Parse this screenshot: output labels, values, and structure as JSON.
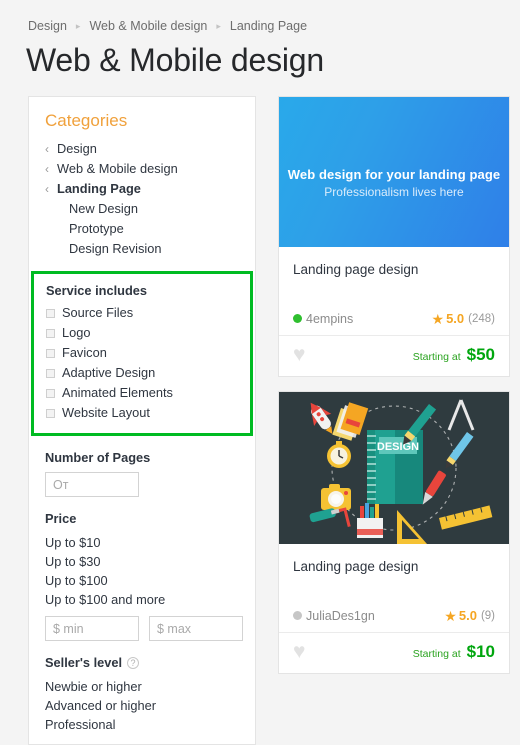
{
  "breadcrumb": {
    "separator": "▸",
    "items": [
      {
        "label": "Design"
      },
      {
        "label": "Web & Mobile design"
      },
      {
        "label": "Landing Page"
      }
    ]
  },
  "page_title": "Web & Mobile design",
  "sidebar": {
    "categories": {
      "title": "Categories",
      "chevron": "‹",
      "parents": [
        {
          "label": "Design",
          "current": false
        },
        {
          "label": "Web & Mobile design",
          "current": false
        },
        {
          "label": "Landing Page",
          "current": true
        }
      ],
      "children": [
        {
          "label": "New Design"
        },
        {
          "label": "Prototype"
        },
        {
          "label": "Design Revision"
        }
      ]
    },
    "service_includes": {
      "title": "Service includes",
      "highlight_color": "#00bb22",
      "options": [
        {
          "label": "Source Files",
          "checked": false
        },
        {
          "label": "Logo",
          "checked": false
        },
        {
          "label": "Favicon",
          "checked": false
        },
        {
          "label": "Adaptive Design",
          "checked": false
        },
        {
          "label": "Animated Elements",
          "checked": false
        },
        {
          "label": "Website Layout",
          "checked": false
        }
      ]
    },
    "number_of_pages": {
      "title": "Number of Pages",
      "input_placeholder": "От",
      "input_value": ""
    },
    "price": {
      "title": "Price",
      "options": [
        {
          "label": "Up to $10"
        },
        {
          "label": "Up to $30"
        },
        {
          "label": "Up to $100"
        },
        {
          "label": "Up to $100 and more"
        }
      ],
      "min_placeholder": "$ min",
      "max_placeholder": "$ max",
      "min_value": "",
      "max_value": ""
    },
    "sellers_level": {
      "title": "Seller's level",
      "help_glyph": "?",
      "options": [
        {
          "label": "Newbie or higher"
        },
        {
          "label": "Advanced or higher"
        },
        {
          "label": "Professional"
        }
      ]
    }
  },
  "cards": [
    {
      "banner": {
        "kind": "gradient-text",
        "headline": "Web design for your landing page",
        "subline": "Professionalism lives here"
      },
      "title": "Landing page design",
      "seller": "4empins",
      "seller_status_color": "#2fbf2f",
      "star_glyph": "★",
      "rating": "5.0",
      "reviews": "(248)",
      "favorite_glyph": "♥",
      "starting_at": "Starting at",
      "price": "$50"
    },
    {
      "banner": {
        "kind": "illustration",
        "notebook_label": "DESIGN",
        "alt": "flat design tools illustration"
      },
      "title": "Landing page design",
      "seller": "JuliaDes1gn",
      "seller_status_color": "#c6c6c6",
      "star_glyph": "★",
      "rating": "5.0",
      "reviews": "(9)",
      "favorite_glyph": "♥",
      "starting_at": "Starting at",
      "price": "$10"
    }
  ]
}
